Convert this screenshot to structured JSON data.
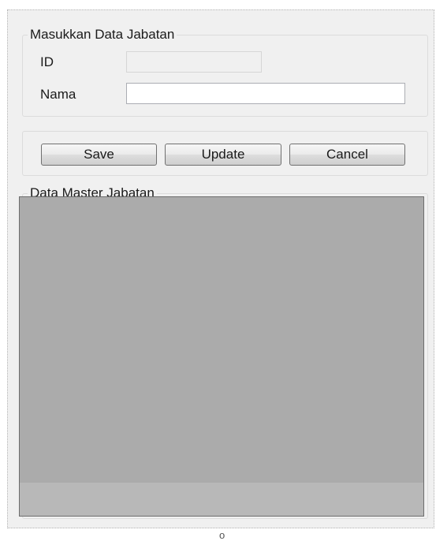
{
  "input_group": {
    "title": "Masukkan Data Jabatan",
    "id_label": "ID",
    "id_value": "",
    "nama_label": "Nama",
    "nama_value": ""
  },
  "actions": {
    "save_label": "Save",
    "update_label": "Update",
    "cancel_label": "Cancel"
  },
  "grid_group": {
    "title": "Data Master Jabatan"
  },
  "bottom_glyph": "o"
}
